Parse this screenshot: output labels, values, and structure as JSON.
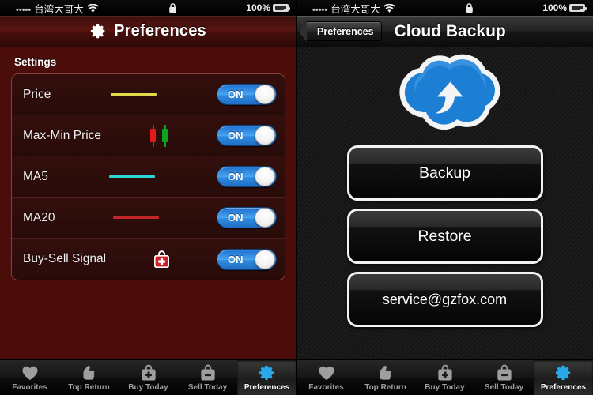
{
  "status_bar": {
    "dots": "•••••",
    "carrier": "台湾大哥大",
    "wifi_icon": "wifi-icon",
    "lock_icon": "lock-icon",
    "battery_percent": "100%",
    "battery_icon": "battery-charging-icon"
  },
  "left_panel": {
    "nav": {
      "gear_icon": "gear-icon",
      "title": "Preferences"
    },
    "section_label": "Settings",
    "rows": [
      {
        "label": "Price",
        "indicator": "line",
        "color": "#e3d84a",
        "toggle": "ON"
      },
      {
        "label": "Max-Min Price",
        "indicator": "candles",
        "color_down": "#e01b1b",
        "color_up": "#0aa61d",
        "toggle": "ON"
      },
      {
        "label": "MA5",
        "indicator": "line",
        "color": "#2ad6d6",
        "toggle": "ON"
      },
      {
        "label": "MA20",
        "indicator": "line",
        "color": "#c22626",
        "toggle": "ON"
      },
      {
        "label": "Buy-Sell Signal",
        "indicator": "medkit",
        "color": "#cf2027",
        "toggle": "ON"
      }
    ],
    "theme": {
      "page_background": "#4a0d0a",
      "row_background": "#2b0f0c",
      "nav_background": "#5a1410",
      "toggle_on_color": "#2f8ddf"
    }
  },
  "right_panel": {
    "nav": {
      "back_label": "Preferences",
      "title": "Cloud Backup"
    },
    "cloud_icon": "cloud-upload-icon",
    "buttons": [
      {
        "label": "Backup"
      },
      {
        "label": "Restore"
      },
      {
        "label": "service@gzfox.com"
      }
    ],
    "theme": {
      "page_background": "#161616",
      "cloud_color": "#1d7fd4"
    }
  },
  "tab_bar": {
    "items": [
      {
        "label": "Favorites",
        "icon": "heart-icon",
        "active": false
      },
      {
        "label": "Top Return",
        "icon": "thumbs-up-icon",
        "active": false
      },
      {
        "label": "Buy Today",
        "icon": "bag-plus-icon",
        "active": false
      },
      {
        "label": "Sell Today",
        "icon": "bag-minus-icon",
        "active": false
      },
      {
        "label": "Preferences",
        "icon": "gear-icon",
        "active": true
      }
    ],
    "active_color": "#2aa9e8"
  }
}
